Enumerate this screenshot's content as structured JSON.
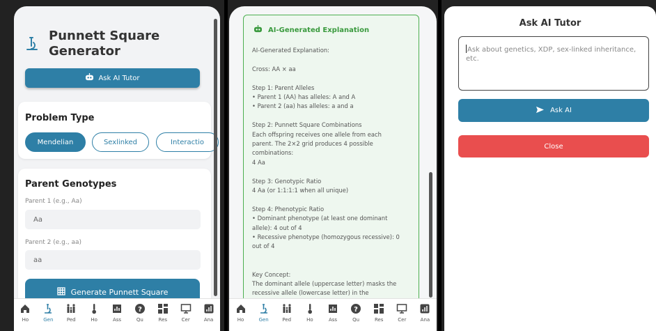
{
  "panel1": {
    "app_title": "Punnett Square Generator",
    "ask_ai_tutor_label": "Ask AI Tutor",
    "problem_type": {
      "title": "Problem Type",
      "options": [
        "Mendelian",
        "Sexlinked",
        "Interactio"
      ],
      "selected": "Mendelian"
    },
    "parent_genotypes": {
      "title": "Parent Genotypes",
      "parent1_label": "Parent 1 (e.g., Aa)",
      "parent1_value": "Aa",
      "parent2_label": "Parent 2 (e.g., aa)",
      "parent2_value": "aa"
    },
    "generate_label": "Generate Punnett Square"
  },
  "nav": {
    "items": [
      {
        "label": "Ho",
        "icon": "home-icon"
      },
      {
        "label": "Gen",
        "icon": "microscope-icon"
      },
      {
        "label": "Ped",
        "icon": "family-icon"
      },
      {
        "label": "Ho",
        "icon": "thermometer-icon"
      },
      {
        "label": "Ass",
        "icon": "assessment-icon"
      },
      {
        "label": "Qu",
        "icon": "question-icon"
      },
      {
        "label": "Res",
        "icon": "grid-icon"
      },
      {
        "label": "Cer",
        "icon": "certificate-icon"
      },
      {
        "label": "Ana",
        "icon": "analytics-icon"
      }
    ],
    "active_index": 1,
    "active_color": "#2e7fa6"
  },
  "panel2": {
    "card_title": "AI-Generated Explanation",
    "lines": [
      "AI-Generated Explanation:",
      "",
      "Cross: AA × aa",
      "",
      "Step 1: Parent Alleles",
      "• Parent 1 (AA) has alleles: A and A",
      "• Parent 2 (aa) has alleles: a and a",
      "",
      "Step 2: Punnett Square Combinations",
      "Each offspring receives one allele from each",
      "parent. The 2×2 grid produces 4 possible",
      "combinations:",
      "4 Aa",
      "",
      "Step 3: Genotypic Ratio",
      "4 Aa (or 1:1:1:1 when all unique)",
      "",
      "Step 4: Phenotypic Ratio",
      "• Dominant phenotype (at least one dominant",
      "allele): 4 out of 4",
      "• Recessive phenotype (homozygous recessive): 0",
      "out of 4",
      "",
      "",
      "Key Concept:",
      "The dominant allele (uppercase letter) masks the",
      "recessive allele (lowercase letter) in the"
    ]
  },
  "panel3": {
    "title": "Ask AI Tutor",
    "input_placeholder": "Ask about genetics, XDP, sex-linked inheritance, etc.",
    "ask_label": "Ask AI",
    "close_label": "Close"
  },
  "colors": {
    "primary": "#2e7fa6",
    "success": "#4caf50",
    "danger": "#e94e4e"
  }
}
